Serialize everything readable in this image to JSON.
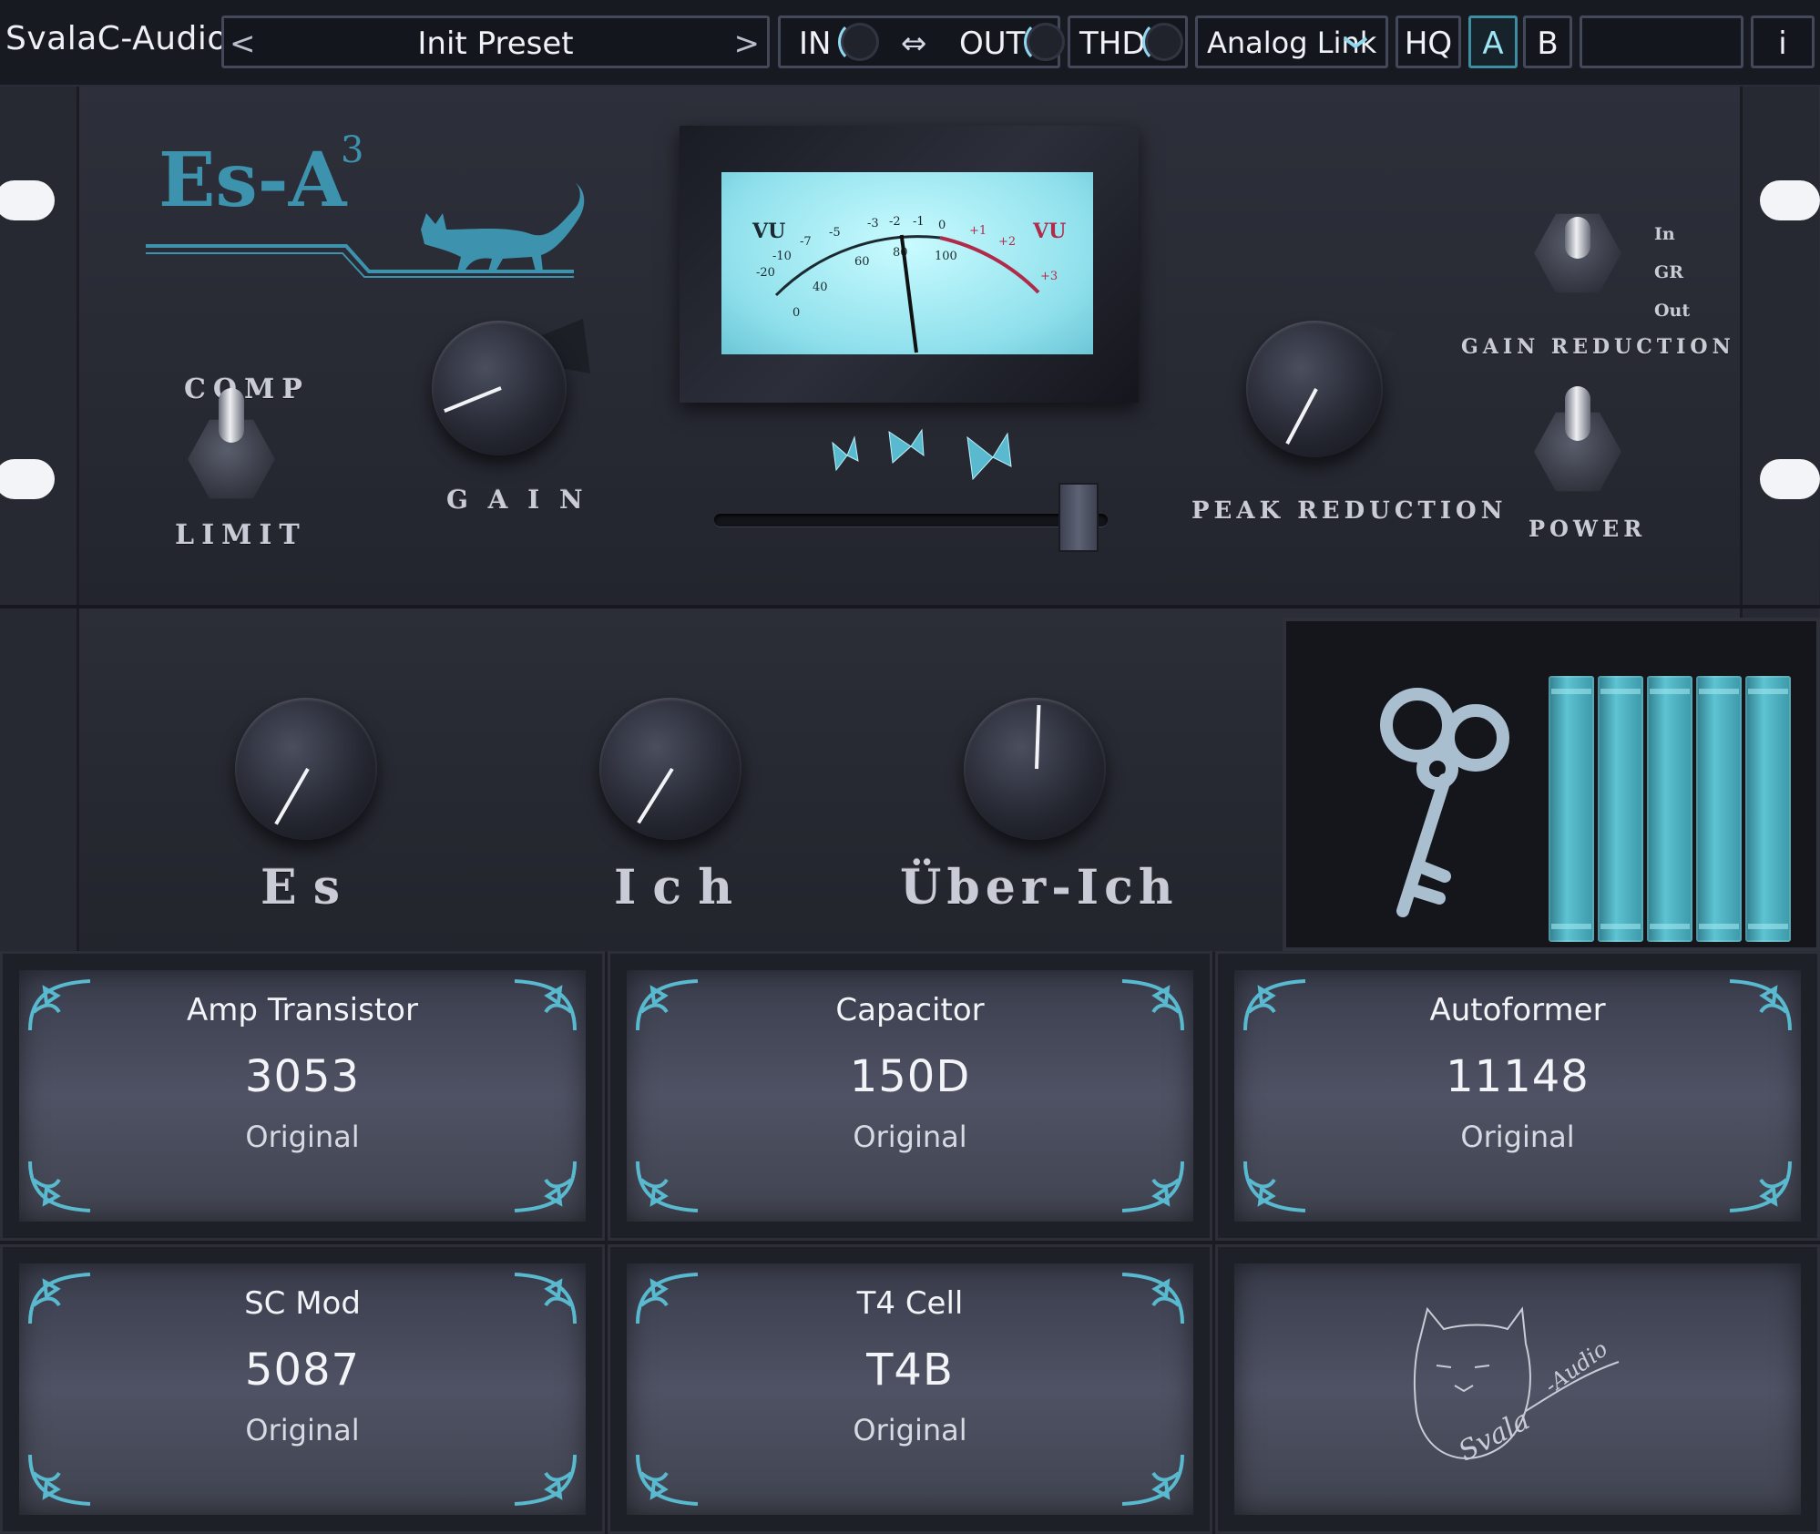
{
  "header": {
    "brand": "SvalaC-Audio",
    "preset_name": "Init Preset",
    "preset_prev_glyph": "<",
    "preset_next_glyph": ">",
    "in_label": "IN",
    "link_glyph": "⇔",
    "out_label": "OUT",
    "thd_label": "THD",
    "mode_value": "Analog Link",
    "hq_label": "HQ",
    "a_label": "A",
    "b_label": "B",
    "info_label": "i"
  },
  "top_panel": {
    "logo_text": "Es-A",
    "logo_superscript": "3",
    "comp_label": "COMP",
    "limit_label": "LIMIT",
    "gain_label": "G A I N",
    "peak_reduction_label": "PEAK REDUCTION",
    "meter_mode_options": [
      "In",
      "GR",
      "Out"
    ],
    "gain_reduction_label": "GAIN REDUCTION",
    "power_label": "POWER"
  },
  "vu_meter": {
    "left_label": "VU",
    "right_label": "VU",
    "scale_db": [
      "-20",
      "-10",
      "-7",
      "-5",
      "-3",
      "-2",
      "-1",
      "0",
      "+1",
      "+2",
      "+3"
    ],
    "scale_pct": [
      "0",
      "40",
      "60",
      "80",
      "100"
    ],
    "needle_db": 0.2
  },
  "mid_panel": {
    "knobs": [
      {
        "label": "E s"
      },
      {
        "label": "I c h"
      },
      {
        "label": "Über-Ich"
      }
    ]
  },
  "modules": [
    {
      "title": "Amp Transistor",
      "value": "3053",
      "sub": "Original"
    },
    {
      "title": "Capacitor",
      "value": "150D",
      "sub": "Original"
    },
    {
      "title": "Autoformer",
      "value": "11148",
      "sub": "Original"
    },
    {
      "title": "SC Mod",
      "value": "5087",
      "sub": "Original"
    },
    {
      "title": "T4 Cell",
      "value": "T4B",
      "sub": "Original"
    }
  ],
  "signature": {
    "text_1": "Svala",
    "text_2": "-Audio"
  },
  "colors": {
    "accent": "#58b9cf",
    "panel": "#2b2d37",
    "topbar": "#181a22",
    "meter_red": "#b02a4a"
  }
}
